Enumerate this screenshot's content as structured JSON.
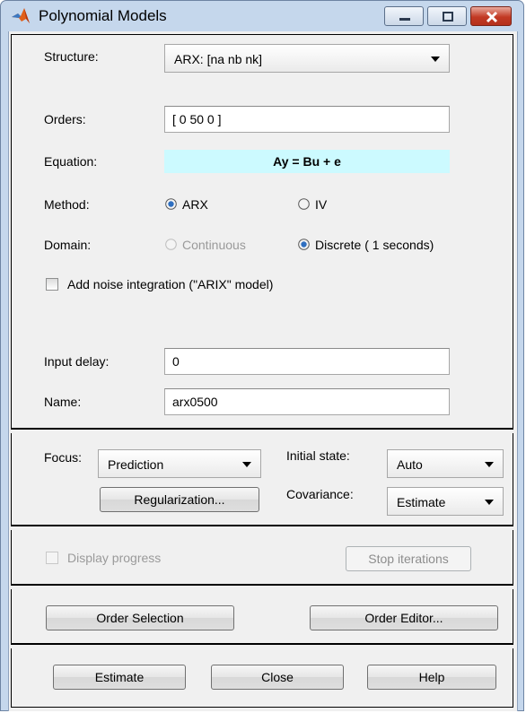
{
  "window": {
    "title": "Polynomial Models",
    "icons": {
      "app": "matlab-logo-icon",
      "minimize": "minimize-icon",
      "maximize": "maximize-icon",
      "close": "close-icon"
    }
  },
  "model": {
    "structure_label": "Structure:",
    "structure_value": "ARX: [na nb nk]",
    "orders_label": "Orders:",
    "orders_value": "[ 0 50 0 ]",
    "equation_label": "Equation:",
    "equation_value": "Ay = Bu + e",
    "method_label": "Method:",
    "method_options": [
      "ARX",
      "IV"
    ],
    "method_selected": "ARX",
    "domain_label": "Domain:",
    "domain_options": [
      "Continuous",
      "Discrete ( 1 seconds)"
    ],
    "domain_selected": "Discrete ( 1 seconds)",
    "noise_integration_label": "Add noise integration (\"ARIX\" model)",
    "noise_integration_checked": false,
    "input_delay_label": "Input delay:",
    "input_delay_value": "0",
    "name_label": "Name:",
    "name_value": "arx0500"
  },
  "options": {
    "focus_label": "Focus:",
    "focus_value": "Prediction",
    "initial_state_label": "Initial state:",
    "initial_state_value": "Auto",
    "regularization_button": "Regularization...",
    "covariance_label": "Covariance:",
    "covariance_value": "Estimate"
  },
  "progress": {
    "display_progress_label": "Display progress",
    "display_progress_checked": false,
    "stop_iterations_button": "Stop iterations"
  },
  "order_tools": {
    "order_selection_button": "Order Selection",
    "order_editor_button": "Order Editor..."
  },
  "actions": {
    "estimate_button": "Estimate",
    "close_button": "Close",
    "help_button": "Help"
  },
  "colors": {
    "equation_background": "#ccfaff",
    "window_frame": "#c5d7ec",
    "close_button": "#c23a24"
  }
}
